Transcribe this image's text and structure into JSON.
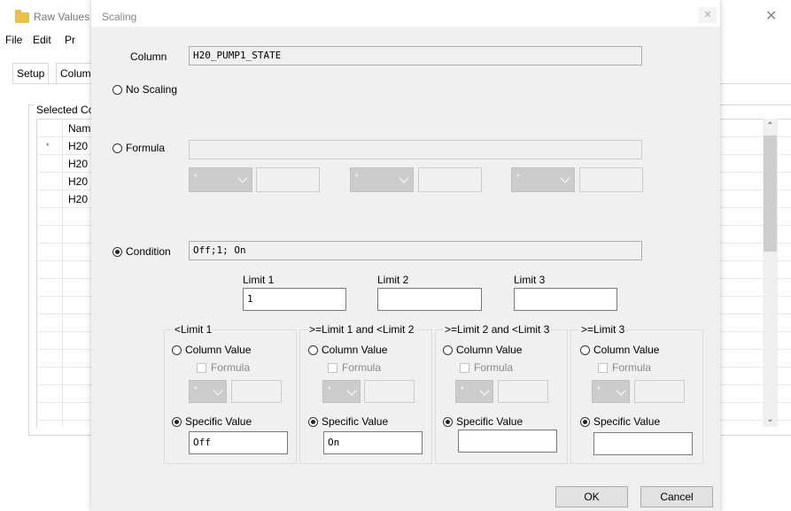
{
  "background_window": {
    "title": "Raw Values",
    "menu": [
      "File",
      "Edit",
      "Pr"
    ],
    "tabs": [
      "Setup",
      "Colum"
    ],
    "group_title": "Selected Co",
    "grid": {
      "header": "Nam",
      "rows": [
        "H20",
        "H20",
        "H20",
        "H20"
      ],
      "new_row_marker": "*"
    }
  },
  "dialog": {
    "title": "Scaling",
    "column_label": "Column",
    "column_value": "H20_PUMP1_STATE",
    "no_scaling_label": "No Scaling",
    "formula_label": "Formula",
    "formula_value": "",
    "formula_operators": [
      "*",
      "*",
      "*"
    ],
    "condition_label": "Condition",
    "condition_value": "Off;1; On",
    "selected_mode": "Condition",
    "limits": [
      {
        "label": "Limit 1",
        "value": "1"
      },
      {
        "label": "Limit 2",
        "value": ""
      },
      {
        "label": "Limit 3",
        "value": ""
      }
    ],
    "ranges": [
      {
        "title": "<Limit 1",
        "column_value_label": "Column Value",
        "formula_label": "Formula",
        "operator": "*",
        "specific_value_label": "Specific Value",
        "specific_value": "Off"
      },
      {
        "title": ">=Limit 1 and <Limit 2",
        "column_value_label": "Column Value",
        "formula_label": "Formula",
        "operator": "*",
        "specific_value_label": "Specific Value",
        "specific_value": "On"
      },
      {
        "title": ">=Limit 2 and <Limit 3",
        "column_value_label": "Column Value",
        "formula_label": "Formula",
        "operator": "*",
        "specific_value_label": "Specific Value",
        "specific_value": ""
      },
      {
        "title": ">=Limit 3",
        "column_value_label": "Column Value",
        "formula_label": "Formula",
        "operator": "*",
        "specific_value_label": "Specific Value",
        "specific_value": ""
      }
    ],
    "ok_label": "OK",
    "cancel_label": "Cancel"
  }
}
